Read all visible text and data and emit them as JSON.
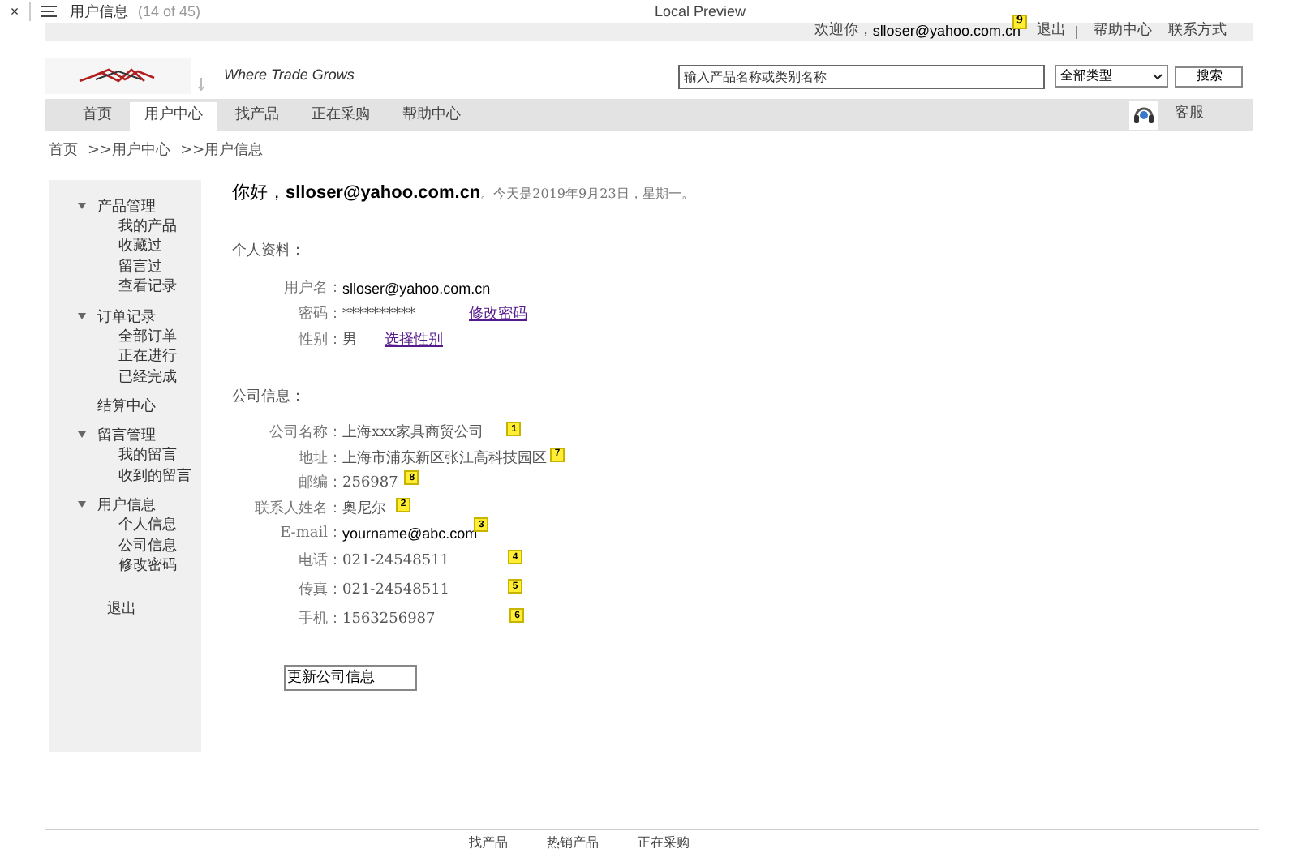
{
  "preview_bar": {
    "close": "×",
    "title": "用户信息",
    "count": "(14 of 45)",
    "label": "Local Preview"
  },
  "top_bar": {
    "greeting": "欢迎你，",
    "user": "slloser@yahoo.com.cn",
    "badge": "9",
    "links": [
      "退出",
      "帮助中心",
      "联系方式"
    ]
  },
  "header": {
    "slogan": "Where Trade Grows",
    "search": {
      "placeholder": "输入产品名称或类别名称"
    },
    "category": "全部类型",
    "search_button": "搜索"
  },
  "nav": {
    "tabs": [
      {
        "label": "首页",
        "selected": false
      },
      {
        "label": "用户中心",
        "selected": true
      },
      {
        "label": "找产品",
        "selected": false
      },
      {
        "label": "正在采购",
        "selected": false
      },
      {
        "label": "帮助中心",
        "selected": false
      }
    ],
    "service": "客服"
  },
  "breadcrumb": [
    "首页",
    ">>用户中心",
    ">>用户信息"
  ],
  "sidebar": {
    "groups": [
      {
        "label": "产品管理",
        "expanded": true,
        "children": [
          "我的产品",
          "收藏过",
          "留言过",
          "查看记录"
        ]
      },
      {
        "label": "订单记录",
        "expanded": true,
        "children": [
          "全部订单",
          "正在进行",
          "已经完成"
        ]
      },
      {
        "label": "结算中心",
        "expanded": false
      },
      {
        "label": "留言管理",
        "expanded": true,
        "children": [
          "我的留言",
          "收到的留言"
        ]
      },
      {
        "label": "用户信息",
        "expanded": true,
        "children": [
          "个人信息",
          "公司信息",
          "修改密码"
        ]
      }
    ],
    "logout": "退出"
  },
  "greeting": {
    "hello": "你好，",
    "user": "slloser@yahoo.com.cn",
    "date": "。今天是2019年9月23日，星期一。"
  },
  "personal": {
    "title": "个人资料：",
    "fields": [
      {
        "label": "用户名：",
        "value": "slloser@yahoo.com.cn",
        "kind": "sans"
      },
      {
        "label": "密码：",
        "value": "**********",
        "link": "修改密码",
        "kind": "serif"
      },
      {
        "label": "性别：",
        "value": "男",
        "link": "选择性别",
        "kind": "serif"
      }
    ]
  },
  "company": {
    "title": "公司信息：",
    "fields": [
      {
        "label": "公司名称：",
        "value": "上海xxx家具商贸公司",
        "badge": "1",
        "kind": "serif"
      },
      {
        "label": "地址：",
        "value": "上海市浦东新区张江高科技园区",
        "badge": "7",
        "kind": "serif"
      },
      {
        "label": "邮编：",
        "value": "256987",
        "badge": "8",
        "kind": "serif"
      },
      {
        "label": "联系人姓名：",
        "value": "奥尼尔",
        "badge": "2",
        "kind": "serif"
      },
      {
        "label": "E-mail：",
        "value": "yourname@abc.com",
        "badge": "3",
        "kind": "sans"
      },
      {
        "label": "电话：",
        "value": "021-24548511",
        "badge": "4",
        "kind": "serif"
      },
      {
        "label": "传真：",
        "value": "021-24548511",
        "badge": "5",
        "kind": "serif"
      },
      {
        "label": "手机：",
        "value": "1563256987",
        "badge": "6",
        "kind": "serif"
      }
    ],
    "button": "更新公司信息"
  },
  "footer": [
    "找产品",
    "热销产品",
    "正在采购"
  ]
}
